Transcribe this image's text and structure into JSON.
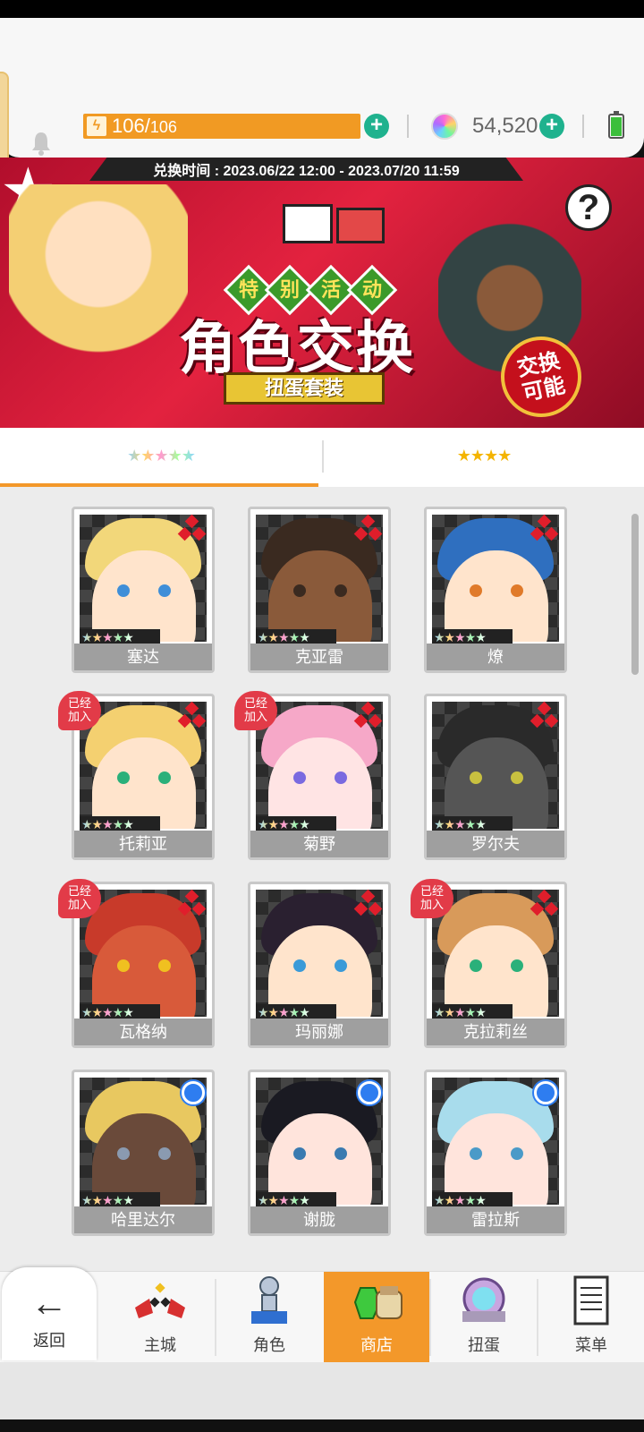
{
  "header": {
    "stamina_current": "106",
    "stamina_separator": "/",
    "stamina_max": "106",
    "gems": "54,520"
  },
  "banner": {
    "exchange_time": "兑换时间 : 2023.06/22 12:00 - 2023.07/20 11:59",
    "event_chars": [
      "特",
      "别",
      "活",
      "动"
    ],
    "title": "角色交换",
    "ribbon": "扭蛋套装",
    "badge_line1": "交换",
    "badge_line2": "可能",
    "help": "?"
  },
  "tabs": {
    "five_star": "★★★★★",
    "four_star": "★★★★"
  },
  "cards": [
    {
      "name": "塞达",
      "stars": "★★★★★",
      "joined": false,
      "marker": "diamond"
    },
    {
      "name": "克亚雷",
      "stars": "★★★★★",
      "joined": false,
      "marker": "diamond"
    },
    {
      "name": "燎",
      "stars": "★★★★★",
      "joined": false,
      "marker": "diamond"
    },
    {
      "name": "托莉亚",
      "stars": "★★★★★",
      "joined": true,
      "marker": "diamond"
    },
    {
      "name": "菊野",
      "stars": "★★★★★",
      "joined": true,
      "marker": "diamond"
    },
    {
      "name": "罗尔夫",
      "stars": "★★★★★",
      "joined": false,
      "marker": "diamond"
    },
    {
      "name": "瓦格纳",
      "stars": "★★★★★",
      "joined": true,
      "marker": "diamond"
    },
    {
      "name": "玛丽娜",
      "stars": "★★★★★",
      "joined": false,
      "marker": "diamond"
    },
    {
      "name": "克拉莉丝",
      "stars": "★★★★★",
      "joined": true,
      "marker": "diamond"
    },
    {
      "name": "哈里达尔",
      "stars": "★★★★★",
      "joined": false,
      "marker": "blue-circle"
    },
    {
      "name": "谢胧",
      "stars": "★★★★★",
      "joined": false,
      "marker": "blue-circle"
    },
    {
      "name": "雷拉斯",
      "stars": "★★★★★",
      "joined": false,
      "marker": "blue-circle"
    }
  ],
  "joined_label_1": "已经",
  "joined_label_2": "加入",
  "nav": {
    "back": "返回",
    "items": [
      {
        "label": "主城",
        "icon": "castle-icon"
      },
      {
        "label": "角色",
        "icon": "character-icon"
      },
      {
        "label": "商店",
        "icon": "shop-icon",
        "active": true
      },
      {
        "label": "扭蛋",
        "icon": "gacha-icon"
      },
      {
        "label": "菜单",
        "icon": "menu-icon"
      }
    ]
  },
  "colors": {
    "accent": "#f3982a",
    "plus": "#1fb28e",
    "diamond": "#e01e2b",
    "joined_badge": "#e23b48"
  }
}
